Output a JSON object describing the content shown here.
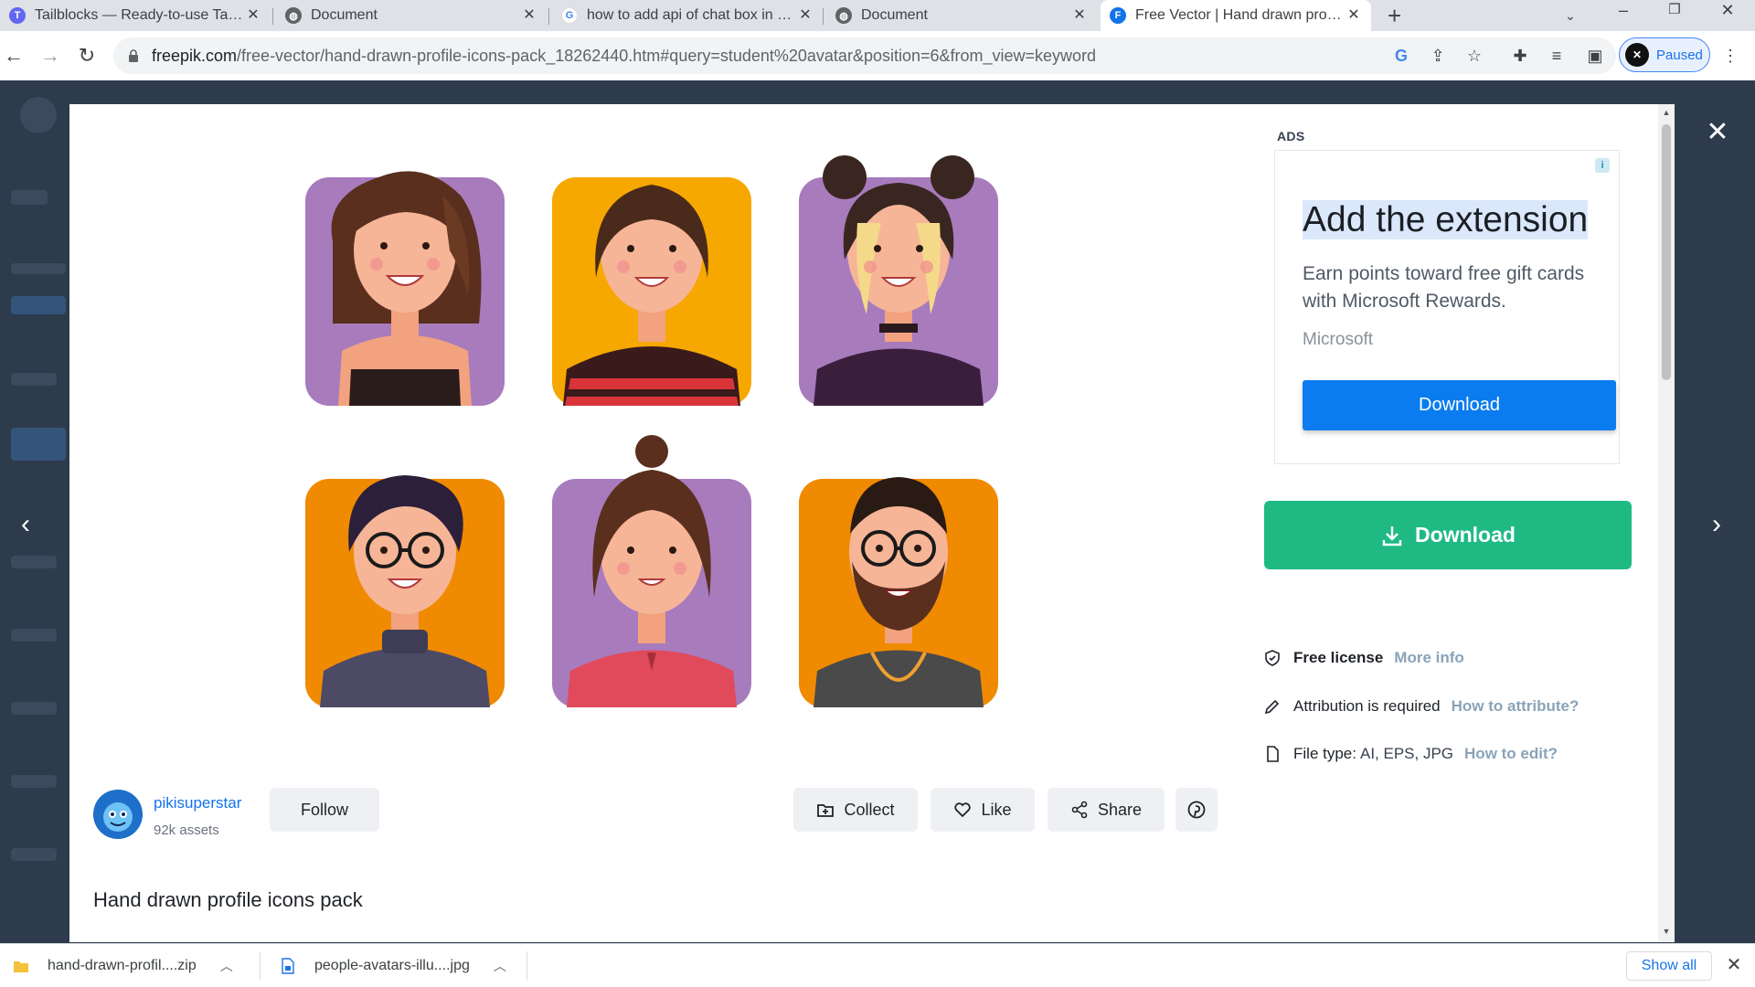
{
  "browser": {
    "tabs": [
      {
        "title": "Tailblocks — Ready-to-use Tailwi"
      },
      {
        "title": "Document"
      },
      {
        "title": "how to add api of chat box in css"
      },
      {
        "title": "Document"
      },
      {
        "title": "Free Vector | Hand drawn profile"
      }
    ],
    "url_host": "freepik.com",
    "url_path": "/free-vector/hand-drawn-profile-icons-pack_18262440.htm#query=student%20avatar&position=6&from_view=keyword",
    "profile_label": "Paused"
  },
  "modal": {
    "author": {
      "name": "pikisuperstar",
      "assets": "92k assets",
      "follow_label": "Follow"
    },
    "actions": {
      "collect": "Collect",
      "like": "Like",
      "share": "Share"
    },
    "title": "Hand drawn profile icons pack",
    "ads": {
      "label": "ADS",
      "headline": "Add the extension",
      "description": "Earn points toward free gift cards with Microsoft Rewards.",
      "brand": "Microsoft",
      "button": "Download"
    },
    "download_label": "Download",
    "license": {
      "free_license": "Free license",
      "free_license_link": "More info",
      "attribution": "Attribution is required",
      "attribution_link": "How to attribute?",
      "file_type_label": "File type:",
      "file_type_value": "AI, EPS, JPG",
      "file_type_link": "How to edit?"
    }
  },
  "downloads": {
    "items": [
      {
        "name": "hand-drawn-profil....zip"
      },
      {
        "name": "people-avatars-illu....jpg"
      }
    ],
    "show_all": "Show all"
  },
  "colors": {
    "accent_green": "#1fba84",
    "ad_blue": "#0a7cf0",
    "link_blue": "#1273eb",
    "tile_purple": "#a87bbd",
    "tile_yellow": "#f6a800",
    "tile_orange": "#f08a00"
  }
}
